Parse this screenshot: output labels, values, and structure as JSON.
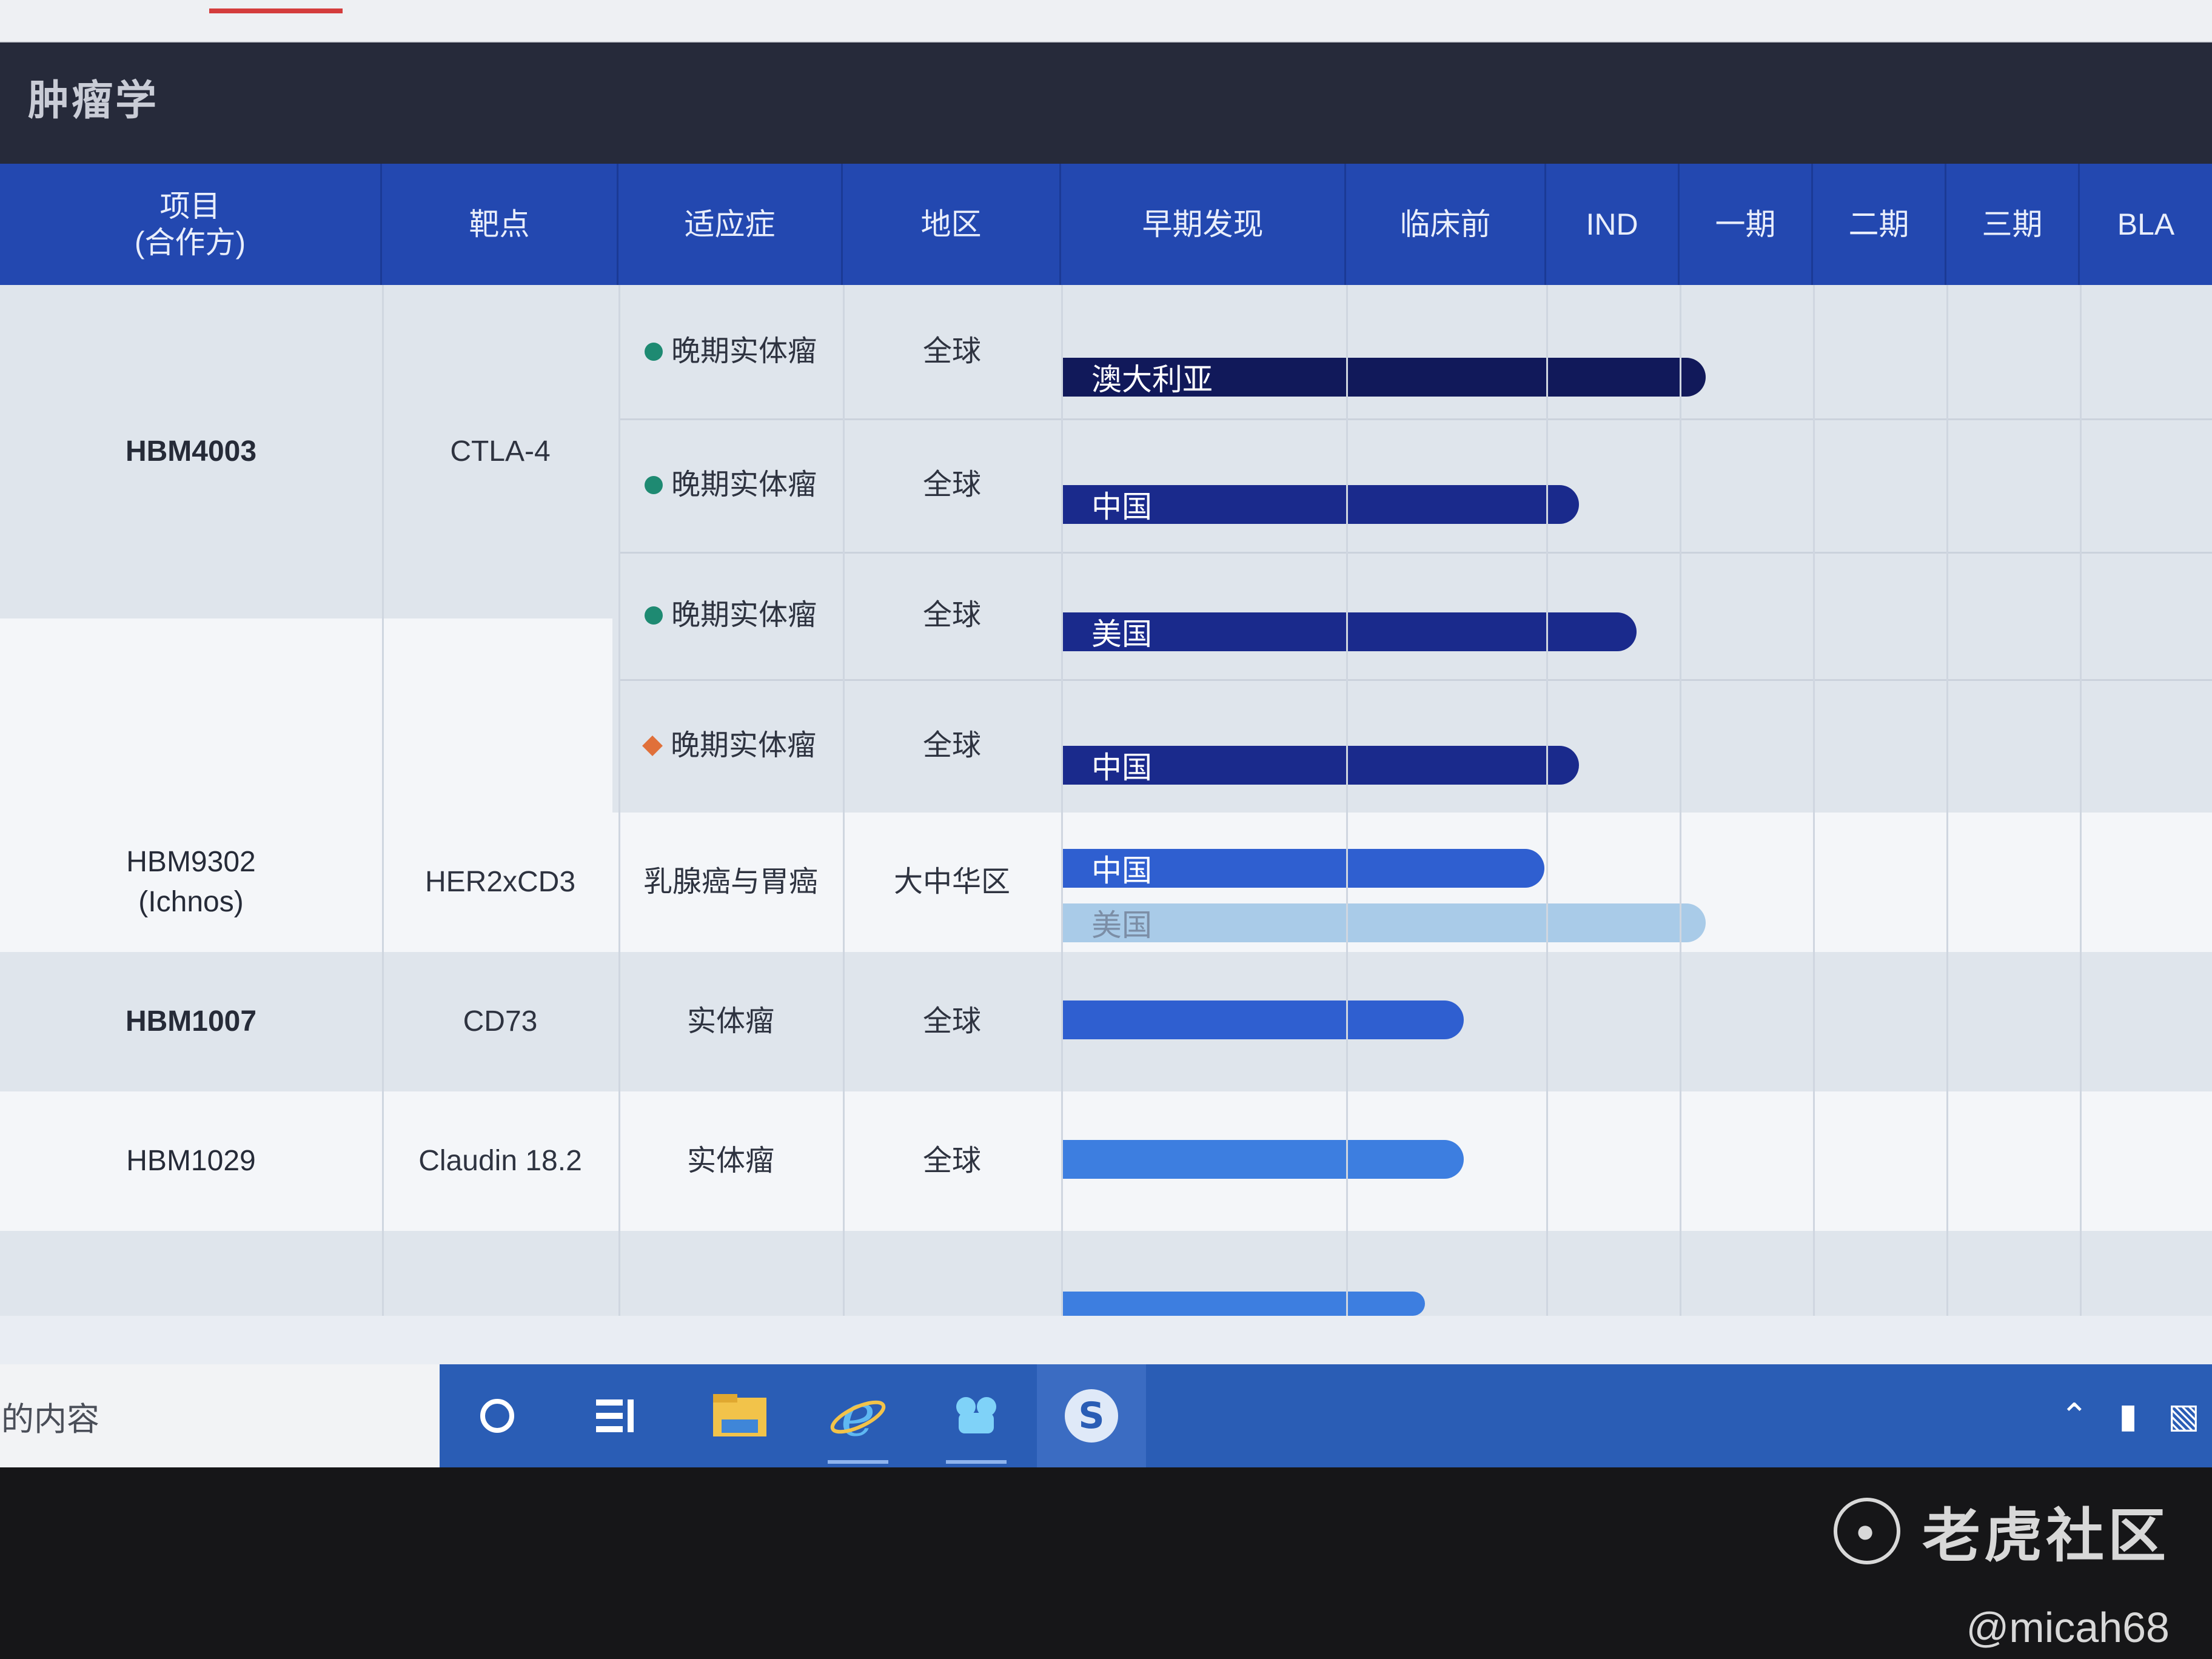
{
  "app": {
    "section_title": "肿瘤学"
  },
  "header": [
    {
      "label": "项目\n(合作方)"
    },
    {
      "label": "靶点"
    },
    {
      "label": "适应症"
    },
    {
      "label": "地区"
    },
    {
      "label": "早期发现"
    },
    {
      "label": "临床前"
    },
    {
      "label": "IND"
    },
    {
      "label": "一期"
    },
    {
      "label": "二期"
    },
    {
      "label": "三期"
    },
    {
      "label": "BLA"
    }
  ],
  "projects": [
    {
      "name": "HBM4003",
      "target": "CTLA-4"
    },
    {
      "name": "HBM9302\n(Ichnos)",
      "target": "HER2xCD3",
      "indication": "乳腺癌与胃癌",
      "region": "大中华区"
    },
    {
      "name": "HBM1007",
      "target": "CD73",
      "indication": "实体瘤",
      "region": "全球"
    },
    {
      "name": "HBM1029",
      "target": "Claudin 18.2",
      "indication": "实体瘤",
      "region": "全球"
    }
  ],
  "hbm4003_rows": [
    {
      "indication": "晚期实体瘤",
      "region": "全球",
      "bar_label": "澳大利亚",
      "marker": "dot",
      "progress": 0.56
    },
    {
      "indication": "晚期实体瘤",
      "region": "全球",
      "bar_label": "中国",
      "marker": "dot",
      "progress": 0.45
    },
    {
      "indication": "晚期实体瘤",
      "region": "全球",
      "bar_label": "美国",
      "marker": "dot",
      "progress": 0.5
    },
    {
      "indication": "晚期实体瘤",
      "region": "全球",
      "bar_label": "中国",
      "marker": "diamond",
      "progress": 0.45
    }
  ],
  "hbm9302_bars": [
    {
      "label": "中国",
      "progress": 0.42
    },
    {
      "label": "美国",
      "progress": 0.56
    }
  ],
  "single_bars": [
    {
      "label": "",
      "progress": 0.35
    },
    {
      "label": "",
      "progress": 0.35
    }
  ],
  "taskbar": {
    "search_text": "的内容",
    "icons": [
      "cortana-icon",
      "task-view-icon",
      "file-explorer-icon",
      "internet-explorer-icon",
      "app-icon",
      "sogou-icon"
    ]
  },
  "watermark": {
    "brand": "老虎社区",
    "user": "@micah68"
  },
  "colors": {
    "header": "#2348b0",
    "title_bar": "#262a3a",
    "bar_dark": "#11195a",
    "bar_mid": "#1a2a8c",
    "bar_light": "#3d7ee0",
    "dot_green": "#1e8a72",
    "diamond_orange": "#e0703a"
  }
}
